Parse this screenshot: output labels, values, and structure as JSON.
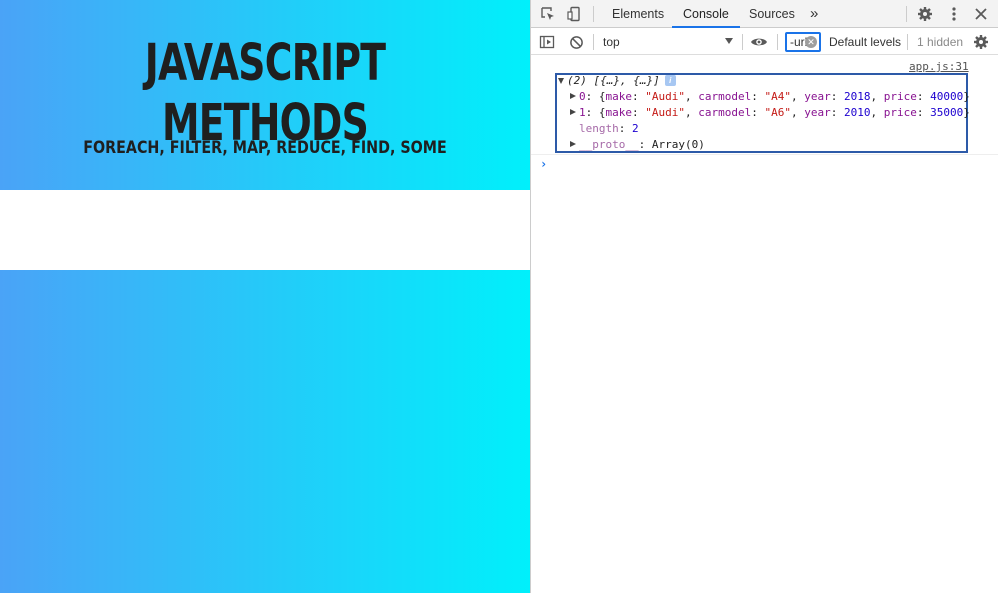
{
  "page": {
    "title": "JAVASCRIPT METHODS",
    "subtitle": "FOREACH, FILTER, MAP, REDUCE, FIND, SOME"
  },
  "devtools": {
    "tabs": [
      "Elements",
      "Console",
      "Sources"
    ],
    "active_tab": "Console",
    "more_tabs_glyph": "»",
    "context": "top",
    "filter_value": "-url",
    "levels_label": "Default levels",
    "hidden_label": "1 hidden",
    "icons": [
      "inspect-icon",
      "device-toggle-icon",
      "sidebar-icon",
      "clear-console-icon",
      "eye-icon",
      "settings-icon",
      "kebab-menu-icon",
      "close-icon"
    ]
  },
  "console": {
    "source": "app.js:31",
    "summary": "(2) [{…}, {…}]",
    "badge": "i",
    "entries": [
      {
        "index": "0",
        "make": "\"Audi\"",
        "carmodel": "\"A4\"",
        "year": "2018",
        "price": "40000"
      },
      {
        "index": "1",
        "make": "\"Audi\"",
        "carmodel": "\"A6\"",
        "year": "2010",
        "price": "35000"
      }
    ],
    "length_key": "length",
    "length_value": "2",
    "proto_key": "__proto__",
    "proto_value": "Array(0)",
    "prompt": "›"
  },
  "colors": {
    "gradient_start": "#4aa3f7",
    "gradient_end": "#00f0fb",
    "accent": "#1a73e8",
    "highlight_box": "#2d5aa8"
  }
}
